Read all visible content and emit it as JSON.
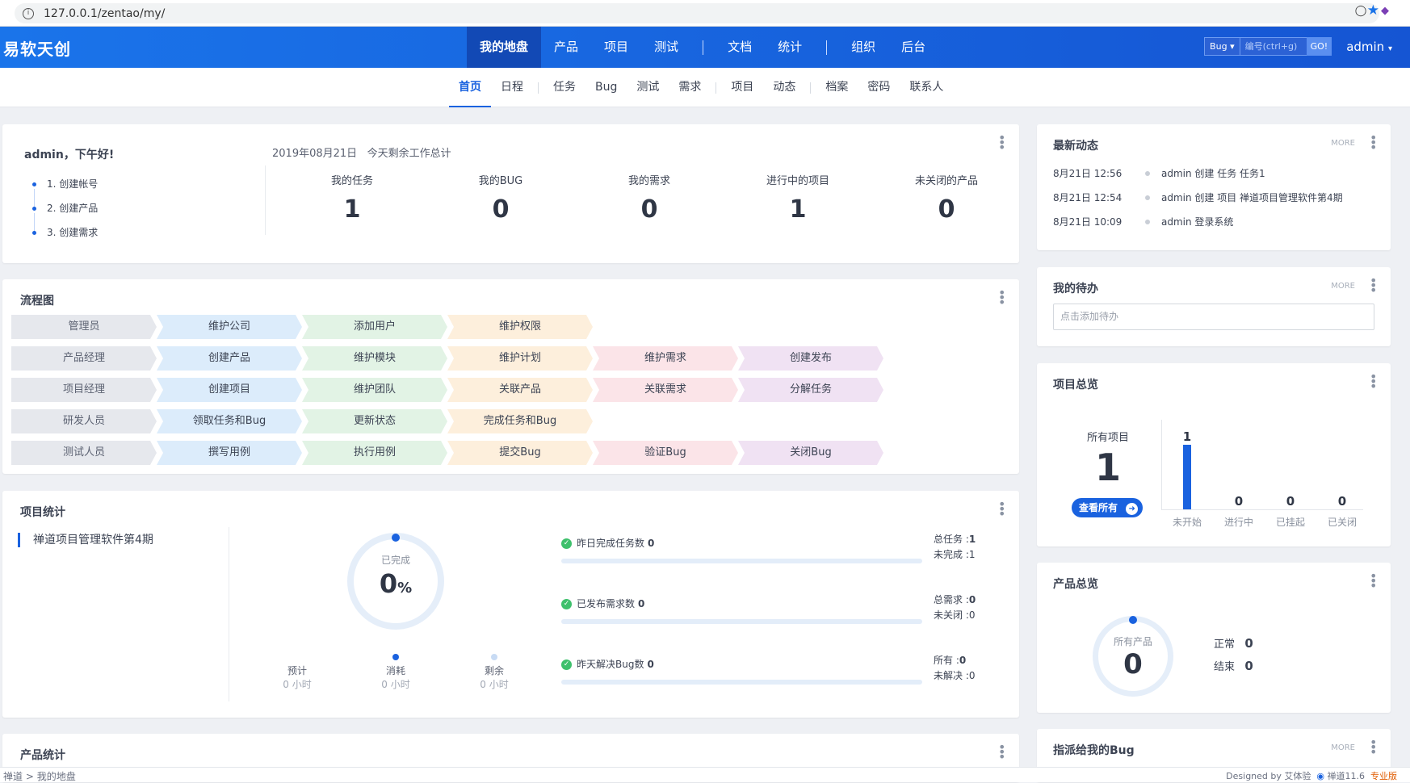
{
  "browser": {
    "url": "127.0.0.1/zentao/my/"
  },
  "header": {
    "brand": "易软天创",
    "nav_group1": [
      "我的地盘",
      "产品",
      "项目",
      "测试"
    ],
    "nav_group2": [
      "文档",
      "统计"
    ],
    "nav_group3": [
      "组织",
      "后台"
    ],
    "search_type": "Bug",
    "search_placeholder": "编号(ctrl+g)",
    "go_label": "GO!",
    "user": "admin"
  },
  "subnav": {
    "group1": [
      "首页",
      "日程"
    ],
    "group2": [
      "任务",
      "Bug",
      "测试",
      "需求"
    ],
    "group3": [
      "项目",
      "动态"
    ],
    "group4": [
      "档案",
      "密码",
      "联系人"
    ]
  },
  "welcome": {
    "greeting": "admin，下午好!",
    "steps": [
      "1. 创建帐号",
      "2. 创建产品",
      "3. 创建需求"
    ],
    "date": "2019年08月21日",
    "summary_title": "今天剩余工作总计",
    "stats": [
      {
        "label": "我的任务",
        "value": "1"
      },
      {
        "label": "我的BUG",
        "value": "0"
      },
      {
        "label": "我的需求",
        "value": "0"
      },
      {
        "label": "进行中的项目",
        "value": "1"
      },
      {
        "label": "未关闭的产品",
        "value": "0"
      }
    ]
  },
  "flow": {
    "title": "流程图",
    "rows": [
      {
        "role": "管理员",
        "steps": [
          "维护公司",
          "添加用户",
          "维护权限"
        ]
      },
      {
        "role": "产品经理",
        "steps": [
          "创建产品",
          "维护模块",
          "维护计划",
          "维护需求",
          "创建发布"
        ]
      },
      {
        "role": "项目经理",
        "steps": [
          "创建项目",
          "维护团队",
          "关联产品",
          "关联需求",
          "分解任务"
        ]
      },
      {
        "role": "研发人员",
        "steps": [
          "领取任务和Bug",
          "更新状态",
          "完成任务和Bug"
        ]
      },
      {
        "role": "测试人员",
        "steps": [
          "撰写用例",
          "执行用例",
          "提交Bug",
          "验证Bug",
          "关闭Bug"
        ]
      }
    ]
  },
  "project_stats": {
    "title": "项目统计",
    "project": "禅道项目管理软件第4期",
    "completed_label": "已完成",
    "completed_value": "0",
    "percent_sign": "%",
    "hours": [
      {
        "label": "预计",
        "value": "0",
        "unit": "小时"
      },
      {
        "label": "消耗",
        "value": "0",
        "unit": "小时"
      },
      {
        "label": "剩余",
        "value": "0",
        "unit": "小时"
      }
    ],
    "bars": [
      {
        "label": "昨日完成任务数",
        "value": "0",
        "r1_label": "总任务 :",
        "r1_value": "1",
        "r2_label": "未完成 :",
        "r2_value": "1"
      },
      {
        "label": "已发布需求数",
        "value": "0",
        "r1_label": "总需求 :",
        "r1_value": "0",
        "r2_label": "未关闭 :",
        "r2_value": "0"
      },
      {
        "label": "昨天解决Bug数",
        "value": "0",
        "r1_label": "所有 :",
        "r1_value": "0",
        "r2_label": "未解决 :",
        "r2_value": "0"
      }
    ]
  },
  "product_stats": {
    "title": "产品统计"
  },
  "activity": {
    "title": "最新动态",
    "more": "MORE",
    "items": [
      {
        "time": "8月21日 12:56",
        "text": "admin 创建 任务 任务1"
      },
      {
        "time": "8月21日 12:54",
        "text": "admin 创建 项目 禅道项目管理软件第4期"
      },
      {
        "time": "8月21日 10:09",
        "text": "admin 登录系统"
      }
    ]
  },
  "todo": {
    "title": "我的待办",
    "more": "MORE",
    "placeholder": "点击添加待办"
  },
  "project_overview": {
    "title": "项目总览",
    "all_label": "所有项目",
    "all_value": "1",
    "view_all": "查看所有",
    "chart_data": {
      "type": "bar",
      "categories": [
        "未开始",
        "进行中",
        "已挂起",
        "已关闭"
      ],
      "values": [
        1,
        0,
        0,
        0
      ]
    },
    "bar_color": "#1a62df"
  },
  "product_overview": {
    "title": "产品总览",
    "all_label": "所有产品",
    "all_value": "0",
    "normal_label": "正常",
    "normal_value": "0",
    "closed_label": "结束",
    "closed_value": "0"
  },
  "assigned_bugs": {
    "title": "指派给我的Bug",
    "more": "MORE"
  },
  "footer": {
    "crumb1": "禅道",
    "crumb2": "我的地盘",
    "designed": "Designed by 艾体验",
    "version": "禅道11.6",
    "edition": "专业版"
  },
  "colors": {
    "accent": "#1a62df",
    "nav_bg": "#1a74ea",
    "success": "#3ec06c"
  }
}
